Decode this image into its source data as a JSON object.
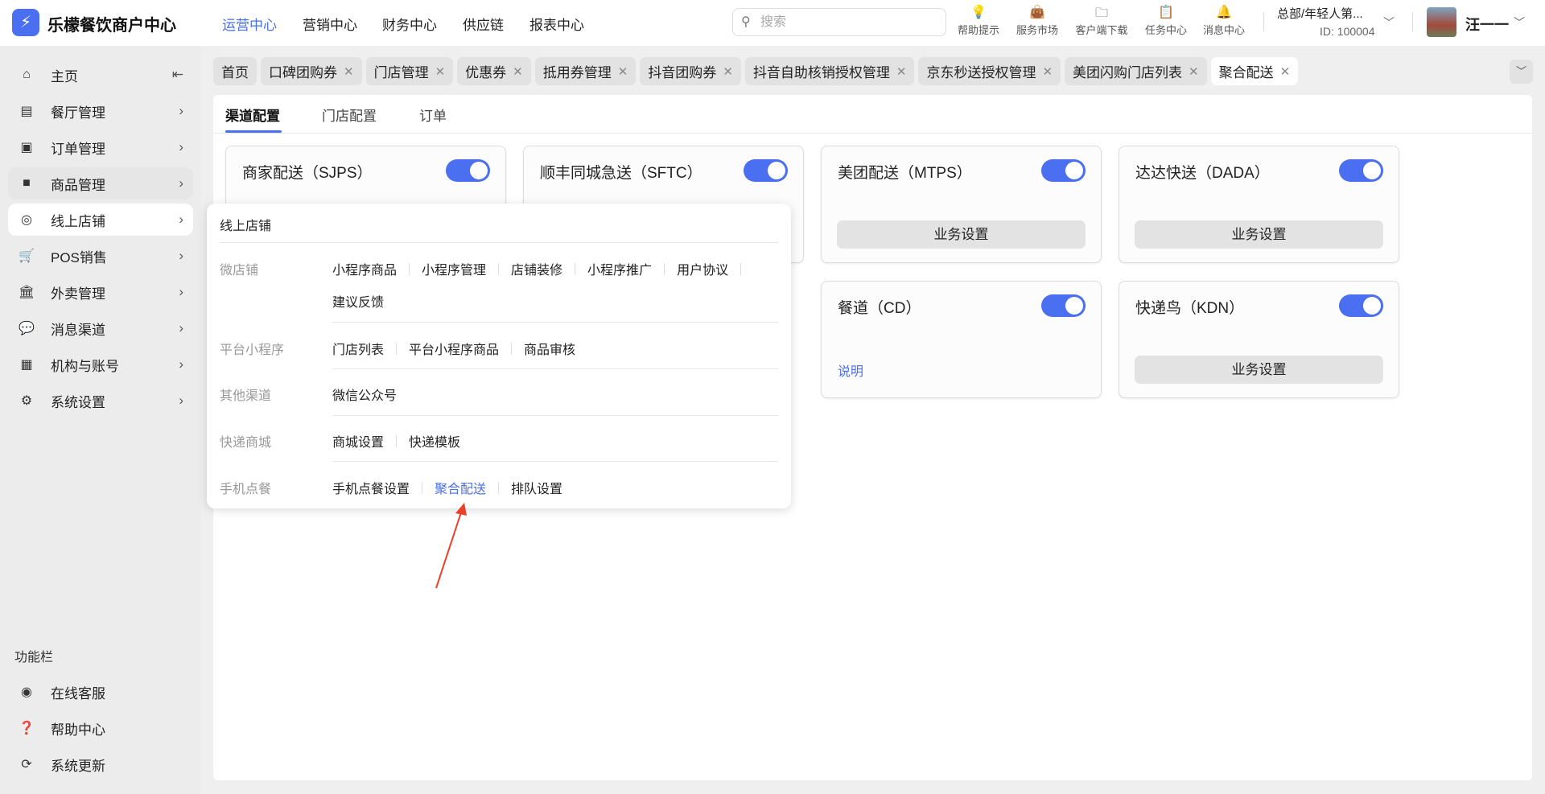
{
  "header": {
    "brand": "乐檬餐饮商户中心",
    "nav": [
      "运营中心",
      "营销中心",
      "财务中心",
      "供应链",
      "报表中心"
    ],
    "active_nav": "运营中心",
    "search_placeholder": "搜索",
    "tools": [
      "帮助提示",
      "服务市场",
      "客户端下载",
      "任务中心",
      "消息中心"
    ],
    "org": "总部/年轻人第...",
    "org_id": "ID: 100004",
    "user": "汪一一"
  },
  "sidebar": {
    "items": [
      "主页",
      "餐厅管理",
      "订单管理",
      "商品管理",
      "线上店铺",
      "POS销售",
      "外卖管理",
      "消息渠道",
      "机构与账号",
      "系统设置"
    ],
    "active": "线上店铺",
    "footer_title": "功能栏",
    "footer_items": [
      "在线客服",
      "帮助中心",
      "系统更新"
    ]
  },
  "tabs": [
    "首页",
    "口碑团购券",
    "门店管理",
    "优惠券",
    "抵用券管理",
    "抖音团购券",
    "抖音自助核销授权管理",
    "京东秒送授权管理",
    "美团闪购门店列表",
    "聚合配送"
  ],
  "active_tab": "聚合配送",
  "inner_tabs": [
    "渠道配置",
    "门店配置",
    "订单"
  ],
  "cards": [
    {
      "title": "商家配送（SJPS）",
      "enabled": true
    },
    {
      "title": "顺丰同城急送（SFTC）",
      "enabled": true
    },
    {
      "title": "美团配送（MTPS）",
      "enabled": true,
      "button": "业务设置"
    },
    {
      "title": "达达快送（DADA）",
      "enabled": true,
      "button": "业务设置"
    },
    {
      "title": "餐道（CD）",
      "enabled": true,
      "link": "说明"
    },
    {
      "title": "快递鸟（KDN）",
      "enabled": true,
      "button": "业务设置"
    }
  ],
  "popup": {
    "title": "线上店铺",
    "groups": [
      {
        "label": "微店铺",
        "items": [
          "小程序商品",
          "小程序管理",
          "店铺装修",
          "小程序推广",
          "用户协议"
        ],
        "items2": [
          "建议反馈"
        ]
      },
      {
        "label": "平台小程序",
        "items": [
          "门店列表",
          "平台小程序商品",
          "商品审核"
        ]
      },
      {
        "label": "其他渠道",
        "items": [
          "微信公众号"
        ]
      },
      {
        "label": "快递商城",
        "items": [
          "商城设置",
          "快递模板"
        ]
      },
      {
        "label": "手机点餐",
        "items": [
          "手机点餐设置",
          "聚合配送",
          "排队设置"
        ]
      }
    ],
    "highlighted": "聚合配送"
  },
  "colors": {
    "accent": "#4a6ff0",
    "annotation_arrow": "#e8412c"
  }
}
